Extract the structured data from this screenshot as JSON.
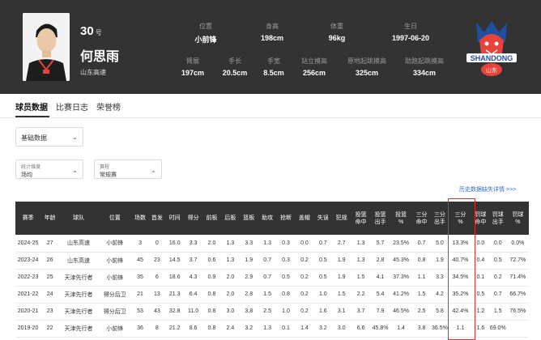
{
  "player": {
    "number": "30",
    "number_unit": "号",
    "name": "何思雨",
    "team": "山东高速"
  },
  "bio": [
    {
      "label": "位置",
      "value": "小前锋"
    },
    {
      "label": "身高",
      "value": "198cm"
    },
    {
      "label": "体重",
      "value": "96kg"
    },
    {
      "label": "生日",
      "value": "1997-06-20"
    },
    {
      "label": "臂展",
      "value": "197cm"
    },
    {
      "label": "手长",
      "value": "20.5cm"
    },
    {
      "label": "手宽",
      "value": "8.5cm"
    },
    {
      "label": "站立摸高",
      "value": "256cm"
    },
    {
      "label": "原地起跳摸高",
      "value": "325cm"
    },
    {
      "label": "助跑起跳摸高",
      "value": "334cm"
    }
  ],
  "logo": {
    "text": "SHANDONG",
    "subtext": "山东",
    "colors": {
      "primary": "#e8433a",
      "secondary": "#1f4fa3"
    }
  },
  "tabs": [
    "球员数据",
    "比赛日志",
    "荣誉榜"
  ],
  "filters": {
    "category": "基础数据",
    "dimension_label": "统计维度",
    "dimension_value": "场均",
    "type_label": "赛程",
    "type_value": "常规赛"
  },
  "link_text": "历史数据缺失详情 >>>",
  "table": {
    "headers": [
      "赛季",
      "年龄",
      "球队",
      "位置",
      "场数",
      "首发",
      "时间",
      "得分",
      "前板",
      "后板",
      "篮板",
      "助攻",
      "抢断",
      "盖帽",
      "失误",
      "犯规",
      "投篮\n命中",
      "投篮\n出手",
      "投篮\n%",
      "三分\n命中",
      "三分\n出手",
      "三分\n%",
      "罚球\n命中",
      "罚球\n出手",
      "罚球\n%"
    ],
    "rows": [
      [
        "2024-25",
        "27",
        "山东高速",
        "小前锋",
        "3",
        "0",
        "16.0",
        "3.3",
        "2.0",
        "1.3",
        "3.3",
        "1.3",
        "0.3",
        "0.0",
        "0.7",
        "2.7",
        "1.3",
        "5.7",
        "23.5%",
        "0.7",
        "5.0",
        "13.3%",
        "0.0",
        "0.0",
        "0.0%"
      ],
      [
        "2023-24",
        "26",
        "山东高速",
        "小前锋",
        "45",
        "23",
        "14.5",
        "3.7",
        "0.6",
        "1.3",
        "1.9",
        "0.7",
        "0.3",
        "0.2",
        "0.5",
        "1.9",
        "1.3",
        "2.8",
        "45.3%",
        "0.8",
        "1.9",
        "40.7%",
        "0.4",
        "0.5",
        "72.7%"
      ],
      [
        "2022-23",
        "25",
        "天津先行者",
        "小前锋",
        "35",
        "6",
        "18.6",
        "4.3",
        "0.9",
        "2.0",
        "2.9",
        "0.7",
        "0.5",
        "0.2",
        "0.5",
        "1.9",
        "1.5",
        "4.1",
        "37.3%",
        "1.1",
        "3.3",
        "34.5%",
        "0.1",
        "0.2",
        "71.4%"
      ],
      [
        "2021-22",
        "24",
        "天津先行者",
        "得分后卫",
        "21",
        "13",
        "21.3",
        "6.4",
        "0.8",
        "2.0",
        "2.8",
        "1.5",
        "0.8",
        "0.2",
        "1.0",
        "1.5",
        "2.2",
        "5.4",
        "41.2%",
        "1.5",
        "4.2",
        "35.2%",
        "0.5",
        "0.7",
        "66.7%"
      ],
      [
        "2020-21",
        "23",
        "天津先行者",
        "得分后卫",
        "53",
        "43",
        "32.8",
        "11.0",
        "0.8",
        "3.0",
        "3.8",
        "2.5",
        "1.0",
        "0.2",
        "1.6",
        "3.1",
        "3.7",
        "7.9",
        "46.5%",
        "2.5",
        "5.8",
        "42.4%",
        "1.2",
        "1.5",
        "76.5%"
      ],
      [
        "2019-20",
        "22",
        "天津先行者",
        "小前锋",
        "36",
        "8",
        "21.2",
        "8.6",
        "0.8",
        "2.4",
        "3.2",
        "1.3",
        "0.1",
        "1.4",
        "3.2",
        "3.0",
        "6.6",
        "45.8%",
        "1.4",
        "3.8",
        "36.5%",
        "1.1",
        "1.6",
        "69.0%",
        ""
      ]
    ]
  }
}
